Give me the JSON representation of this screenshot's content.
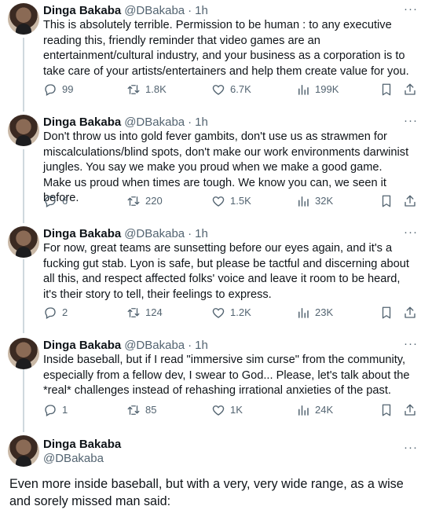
{
  "tweets": [
    {
      "name": "Dinga Bakaba",
      "handle": "@DBakaba",
      "sep": "·",
      "time": "1h",
      "more": "···",
      "text": "This is absolutely terrible. Permission to be human : to any executive reading this, friendly reminder that video games are an entertainment/cultural industry, and your business as a corporation is to take care of your artists/entertainers and help them create value for you.",
      "replies": "99",
      "retweets": "1.8K",
      "likes": "6.7K",
      "views": "199K"
    },
    {
      "name": "Dinga Bakaba",
      "handle": "@DBakaba",
      "sep": "·",
      "time": "1h",
      "more": "···",
      "text": "Don't throw us into gold fever gambits, don't use us as strawmen for miscalculations/blind spots, don't make our work environments darwinist jungles. You say we make you proud when we make a good game. Make us proud when times are tough. We know you can, we seen it before.",
      "replies": "6",
      "retweets": "220",
      "likes": "1.5K",
      "views": "32K"
    },
    {
      "name": "Dinga Bakaba",
      "handle": "@DBakaba",
      "sep": "·",
      "time": "1h",
      "more": "···",
      "text": "For now, great teams are sunsetting before our eyes again, and it's a fucking gut stab. Lyon is safe, but please be tactful and discerning about all this, and respect affected folks' voice and leave it room to be heard, it's their story to tell, their feelings to express.",
      "replies": "2",
      "retweets": "124",
      "likes": "1.2K",
      "views": "23K"
    },
    {
      "name": "Dinga Bakaba",
      "handle": "@DBakaba",
      "sep": "·",
      "time": "1h",
      "more": "···",
      "text": "Inside baseball, but if I read \"immersive sim curse\" from the community, especially from a fellow dev, I swear to God... Please, let's talk about the *real* challenges instead of rehashing irrational anxieties of the past.",
      "replies": "1",
      "retweets": "85",
      "likes": "1K",
      "views": "24K"
    }
  ],
  "main_tweet": {
    "name": "Dinga Bakaba",
    "handle": "@DBakaba",
    "more": "···",
    "text": "Even more inside baseball, but with a very, very wide range, as a wise and sorely missed man said:"
  },
  "icons": {
    "reply": "reply-icon",
    "retweet": "retweet-icon",
    "like": "heart-icon",
    "views": "views-icon",
    "bookmark": "bookmark-icon",
    "share": "share-icon"
  }
}
